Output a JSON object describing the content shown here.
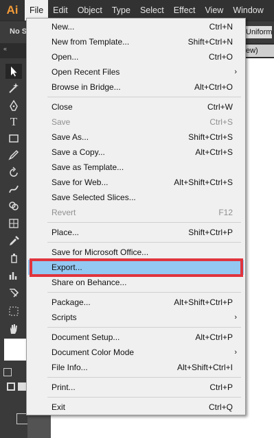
{
  "app": {
    "logo": "Ai"
  },
  "menubar": {
    "items": [
      "File",
      "Edit",
      "Object",
      "Type",
      "Select",
      "Effect",
      "View",
      "Window"
    ]
  },
  "controlbar": {
    "selection": "No Se",
    "uniform": "Uniform"
  },
  "view_tab": "ew)",
  "collapse_icon": "«",
  "file_menu": {
    "new": {
      "label": "New...",
      "shortcut": "Ctrl+N"
    },
    "new_template": {
      "label": "New from Template...",
      "shortcut": "Shift+Ctrl+N"
    },
    "open": {
      "label": "Open...",
      "shortcut": "Ctrl+O"
    },
    "open_recent": {
      "label": "Open Recent Files",
      "arrow": "›"
    },
    "browse_bridge": {
      "label": "Browse in Bridge...",
      "shortcut": "Alt+Ctrl+O"
    },
    "close": {
      "label": "Close",
      "shortcut": "Ctrl+W"
    },
    "save": {
      "label": "Save",
      "shortcut": "Ctrl+S"
    },
    "save_as": {
      "label": "Save As...",
      "shortcut": "Shift+Ctrl+S"
    },
    "save_copy": {
      "label": "Save a Copy...",
      "shortcut": "Alt+Ctrl+S"
    },
    "save_template": {
      "label": "Save as Template..."
    },
    "save_web": {
      "label": "Save for Web...",
      "shortcut": "Alt+Shift+Ctrl+S"
    },
    "save_slices": {
      "label": "Save Selected Slices..."
    },
    "revert": {
      "label": "Revert",
      "shortcut": "F12"
    },
    "place": {
      "label": "Place...",
      "shortcut": "Shift+Ctrl+P"
    },
    "save_office": {
      "label": "Save for Microsoft Office..."
    },
    "export": {
      "label": "Export..."
    },
    "behance": {
      "label": "Share on Behance..."
    },
    "package": {
      "label": "Package...",
      "shortcut": "Alt+Shift+Ctrl+P"
    },
    "scripts": {
      "label": "Scripts",
      "arrow": "›"
    },
    "doc_setup": {
      "label": "Document Setup...",
      "shortcut": "Alt+Ctrl+P"
    },
    "doc_color": {
      "label": "Document Color Mode",
      "arrow": "›"
    },
    "file_info": {
      "label": "File Info...",
      "shortcut": "Alt+Shift+Ctrl+I"
    },
    "print": {
      "label": "Print...",
      "shortcut": "Ctrl+P"
    },
    "exit": {
      "label": "Exit",
      "shortcut": "Ctrl+Q"
    }
  },
  "colors": {
    "highlight": "#93c8f2",
    "annotation": "#e0343d",
    "logo": "#f29b38"
  }
}
